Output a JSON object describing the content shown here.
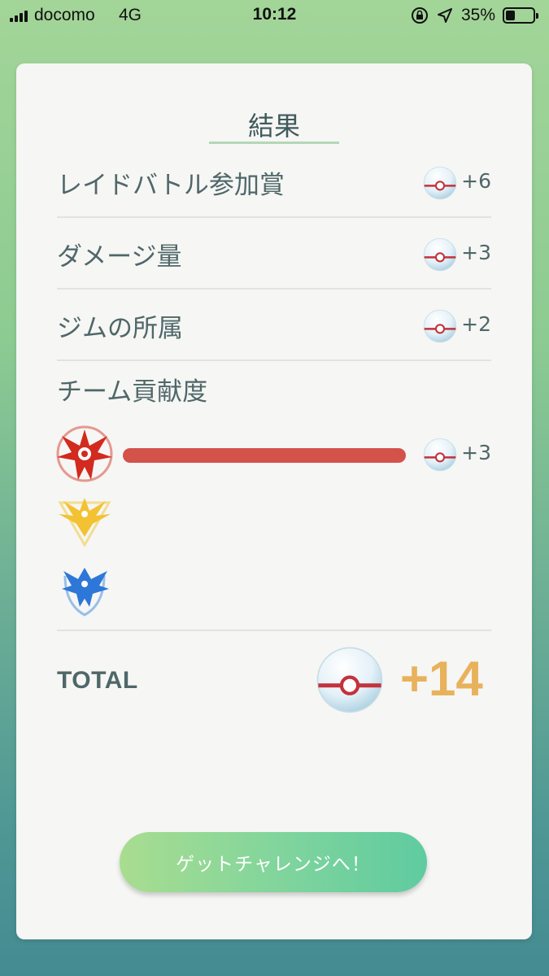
{
  "status_bar": {
    "carrier": "docomo",
    "network": "4G",
    "time": "10:12",
    "battery_percent": "35%",
    "battery_level": 0.35
  },
  "card": {
    "title": "結果",
    "rows": [
      {
        "label": "レイドバトル参加賞",
        "value": "+6",
        "icon": "premier-ball-icon"
      },
      {
        "label": "ダメージ量",
        "value": "+3",
        "icon": "premier-ball-icon"
      },
      {
        "label": "ジムの所属",
        "value": "+2",
        "icon": "premier-ball-icon"
      }
    ],
    "team_section": {
      "label": "チーム貢献度",
      "teams": [
        {
          "name": "valor",
          "icon": "team-valor-icon",
          "color": "#d3524a",
          "contribution": 1.0,
          "value": "+3"
        },
        {
          "name": "instinct",
          "icon": "team-instinct-icon",
          "color": "#f3c640",
          "contribution": 0,
          "value": ""
        },
        {
          "name": "mystic",
          "icon": "team-mystic-icon",
          "color": "#2c7fd8",
          "contribution": 0,
          "value": ""
        }
      ]
    },
    "total": {
      "label": "TOTAL",
      "value": "+14",
      "icon": "premier-ball-icon"
    },
    "button_label": "ゲットチャレンジへ！"
  },
  "colors": {
    "accent_total": "#e8b25c",
    "valor_bar": "#d3524a",
    "button_start": "#a9dd90",
    "button_end": "#5fcba0"
  }
}
